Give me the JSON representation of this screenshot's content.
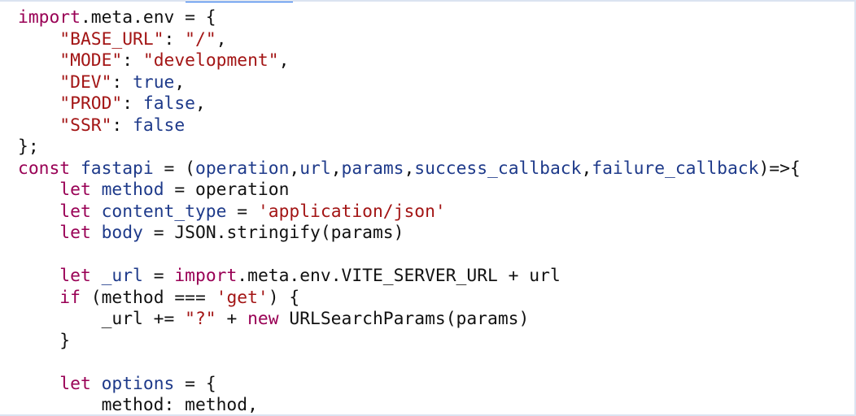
{
  "editor": {
    "lines": [
      [
        {
          "t": "import",
          "c": "kw"
        },
        {
          "t": ".meta.env = {",
          "c": "plain"
        }
      ],
      [
        {
          "t": "    ",
          "c": "plain"
        },
        {
          "t": "\"BASE_URL\"",
          "c": "str"
        },
        {
          "t": ": ",
          "c": "plain"
        },
        {
          "t": "\"/\"",
          "c": "str"
        },
        {
          "t": ",",
          "c": "plain"
        }
      ],
      [
        {
          "t": "    ",
          "c": "plain"
        },
        {
          "t": "\"MODE\"",
          "c": "str"
        },
        {
          "t": ": ",
          "c": "plain"
        },
        {
          "t": "\"development\"",
          "c": "str"
        },
        {
          "t": ",",
          "c": "plain"
        }
      ],
      [
        {
          "t": "    ",
          "c": "plain"
        },
        {
          "t": "\"DEV\"",
          "c": "str"
        },
        {
          "t": ": ",
          "c": "plain"
        },
        {
          "t": "true",
          "c": "id"
        },
        {
          "t": ",",
          "c": "plain"
        }
      ],
      [
        {
          "t": "    ",
          "c": "plain"
        },
        {
          "t": "\"PROD\"",
          "c": "str"
        },
        {
          "t": ": ",
          "c": "plain"
        },
        {
          "t": "false",
          "c": "id"
        },
        {
          "t": ",",
          "c": "plain"
        }
      ],
      [
        {
          "t": "    ",
          "c": "plain"
        },
        {
          "t": "\"SSR\"",
          "c": "str"
        },
        {
          "t": ": ",
          "c": "plain"
        },
        {
          "t": "false",
          "c": "id"
        }
      ],
      [
        {
          "t": "};",
          "c": "plain"
        }
      ],
      [
        {
          "t": "const",
          "c": "kw"
        },
        {
          "t": " ",
          "c": "plain"
        },
        {
          "t": "fastapi",
          "c": "id"
        },
        {
          "t": " = (",
          "c": "plain"
        },
        {
          "t": "operation",
          "c": "id"
        },
        {
          "t": ",",
          "c": "plain"
        },
        {
          "t": "url",
          "c": "id"
        },
        {
          "t": ",",
          "c": "plain"
        },
        {
          "t": "params",
          "c": "id"
        },
        {
          "t": ",",
          "c": "plain"
        },
        {
          "t": "success_callback",
          "c": "id"
        },
        {
          "t": ",",
          "c": "plain"
        },
        {
          "t": "failure_callback",
          "c": "id"
        },
        {
          "t": ")=>{",
          "c": "plain"
        }
      ],
      [
        {
          "t": "    ",
          "c": "plain"
        },
        {
          "t": "let",
          "c": "kw"
        },
        {
          "t": " ",
          "c": "plain"
        },
        {
          "t": "method",
          "c": "id"
        },
        {
          "t": " = operation",
          "c": "plain"
        }
      ],
      [
        {
          "t": "    ",
          "c": "plain"
        },
        {
          "t": "let",
          "c": "kw"
        },
        {
          "t": " ",
          "c": "plain"
        },
        {
          "t": "content_type",
          "c": "id"
        },
        {
          "t": " = ",
          "c": "plain"
        },
        {
          "t": "'application/json'",
          "c": "str"
        }
      ],
      [
        {
          "t": "    ",
          "c": "plain"
        },
        {
          "t": "let",
          "c": "kw"
        },
        {
          "t": " ",
          "c": "plain"
        },
        {
          "t": "body",
          "c": "id"
        },
        {
          "t": " = JSON.stringify(params)",
          "c": "plain"
        }
      ],
      [
        {
          "t": "",
          "c": "plain"
        }
      ],
      [
        {
          "t": "    ",
          "c": "plain"
        },
        {
          "t": "let",
          "c": "kw"
        },
        {
          "t": " ",
          "c": "plain"
        },
        {
          "t": "_url",
          "c": "id"
        },
        {
          "t": " = ",
          "c": "plain"
        },
        {
          "t": "import",
          "c": "kw"
        },
        {
          "t": ".meta.env.VITE_SERVER_URL + url",
          "c": "plain"
        }
      ],
      [
        {
          "t": "    ",
          "c": "plain"
        },
        {
          "t": "if",
          "c": "kw"
        },
        {
          "t": " (method === ",
          "c": "plain"
        },
        {
          "t": "'get'",
          "c": "str"
        },
        {
          "t": ") {",
          "c": "plain"
        }
      ],
      [
        {
          "t": "        _url += ",
          "c": "plain"
        },
        {
          "t": "\"?\"",
          "c": "str"
        },
        {
          "t": " + ",
          "c": "plain"
        },
        {
          "t": "new",
          "c": "kw"
        },
        {
          "t": " URLSearchParams(params)",
          "c": "plain"
        }
      ],
      [
        {
          "t": "    }",
          "c": "plain"
        }
      ],
      [
        {
          "t": "",
          "c": "plain"
        }
      ],
      [
        {
          "t": "    ",
          "c": "plain"
        },
        {
          "t": "let",
          "c": "kw"
        },
        {
          "t": " ",
          "c": "plain"
        },
        {
          "t": "options",
          "c": "id"
        },
        {
          "t": " = {",
          "c": "plain"
        }
      ],
      [
        {
          "t": "        method: method,",
          "c": "plain"
        }
      ]
    ]
  },
  "colors": {
    "keyword": "#990055",
    "identifier": "#1e3a8a",
    "string": "#a31515",
    "text": "#111111",
    "frame_border": "#dbe3f1",
    "active_tab": "#1f6feb"
  }
}
